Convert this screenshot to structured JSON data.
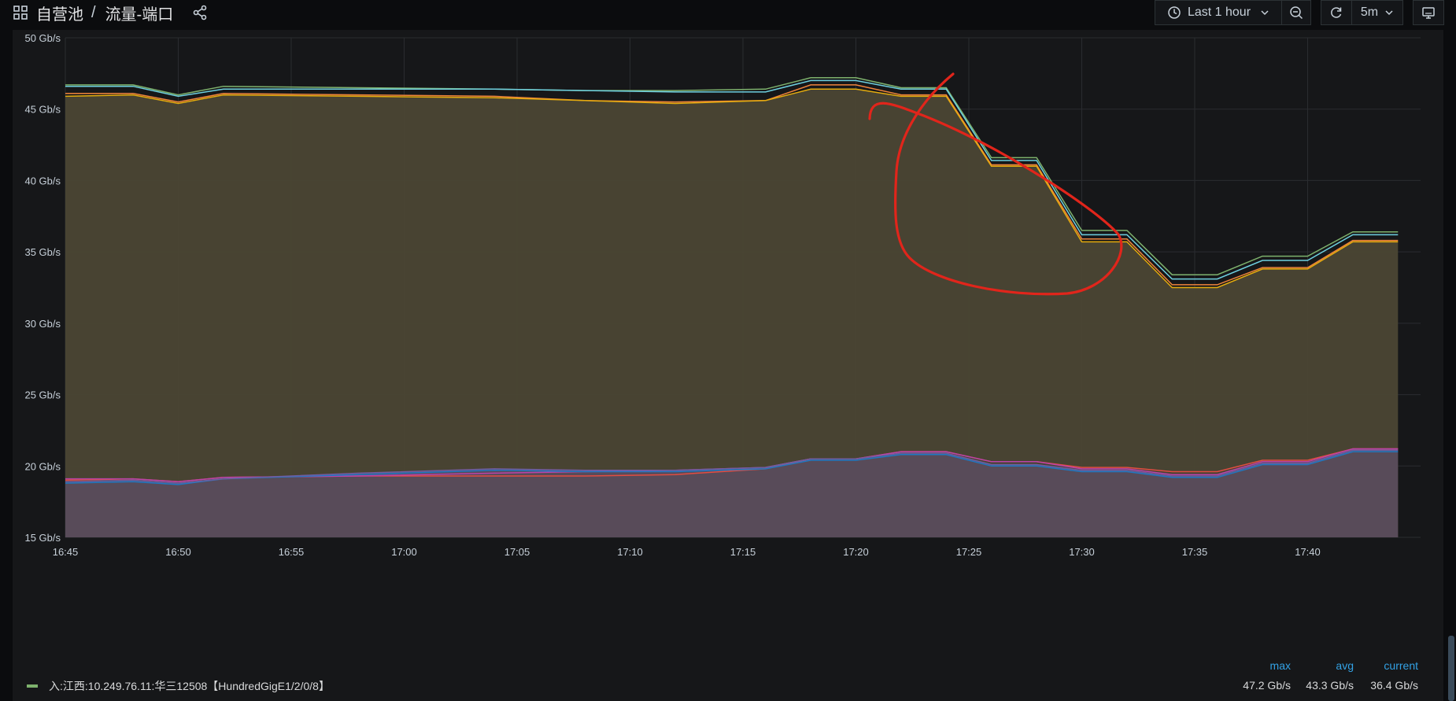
{
  "breadcrumb": {
    "folder": "自营池",
    "separator": "/",
    "dashboard": "流量-端口"
  },
  "toolbar": {
    "time_range": "Last 1 hour",
    "refresh_interval": "5m"
  },
  "icons": {
    "dashboards": "grid-icon",
    "share": "share-icon",
    "clock": "clock-icon",
    "zoom_out": "zoom-out-icon",
    "refresh": "refresh-icon",
    "tv_mode": "tv-mode-icon"
  },
  "chart_data": {
    "type": "area",
    "y_unit": "Gb/s",
    "ylim": [
      15,
      50
    ],
    "ytick_labels": [
      "15 Gb/s",
      "20 Gb/s",
      "25 Gb/s",
      "30 Gb/s",
      "35 Gb/s",
      "40 Gb/s",
      "45 Gb/s",
      "50 Gb/s"
    ],
    "yticks": [
      15,
      20,
      25,
      30,
      35,
      40,
      45,
      50
    ],
    "xtick_labels": [
      "16:45",
      "16:50",
      "16:55",
      "17:00",
      "17:05",
      "17:10",
      "17:15",
      "17:20",
      "17:25",
      "17:30",
      "17:35",
      "17:40"
    ],
    "x": [
      "16:45",
      "16:48",
      "16:50",
      "16:52",
      "16:58",
      "17:04",
      "17:08",
      "17:12",
      "17:16",
      "17:18",
      "17:20",
      "17:22",
      "17:24",
      "17:26",
      "17:28",
      "17:30",
      "17:32",
      "17:34",
      "17:36",
      "17:38",
      "17:40",
      "17:42",
      "17:44"
    ],
    "grid": true,
    "series": [
      {
        "color": "#7eb26d",
        "values": [
          46.7,
          46.7,
          46.0,
          46.6,
          46.5,
          46.4,
          46.3,
          46.3,
          46.4,
          47.2,
          47.2,
          46.5,
          46.5,
          41.6,
          41.6,
          36.5,
          36.5,
          33.4,
          33.4,
          34.7,
          34.7,
          36.4,
          36.4
        ]
      },
      {
        "color": "#6ed0e0",
        "values": [
          46.6,
          46.6,
          45.9,
          46.4,
          46.4,
          46.4,
          46.3,
          46.2,
          46.2,
          47.0,
          47.0,
          46.4,
          46.4,
          41.4,
          41.4,
          36.2,
          36.2,
          33.1,
          33.1,
          34.4,
          34.4,
          36.2,
          36.2
        ]
      },
      {
        "color": "#ef843c",
        "values": [
          46.1,
          46.1,
          45.5,
          46.1,
          46.0,
          45.9,
          45.6,
          45.5,
          45.6,
          46.7,
          46.7,
          46.0,
          46.0,
          41.1,
          41.1,
          35.9,
          35.9,
          32.7,
          32.7,
          33.9,
          33.9,
          35.8,
          35.8
        ]
      },
      {
        "color": "#e5ac0e",
        "values": [
          45.9,
          46.0,
          45.4,
          46.0,
          45.9,
          45.8,
          45.6,
          45.4,
          45.6,
          46.4,
          46.4,
          45.9,
          45.9,
          41.0,
          41.0,
          35.7,
          35.7,
          32.5,
          32.5,
          33.8,
          33.8,
          35.7,
          35.7
        ]
      },
      {
        "color": "#e24d42",
        "values": [
          19.0,
          19.1,
          18.9,
          19.2,
          19.3,
          19.3,
          19.3,
          19.4,
          19.8,
          20.5,
          20.5,
          21.0,
          21.0,
          20.3,
          20.3,
          19.9,
          19.9,
          19.6,
          19.6,
          20.4,
          20.4,
          21.2,
          21.2
        ]
      },
      {
        "color": "#ba43a9",
        "values": [
          19.1,
          19.1,
          18.9,
          19.2,
          19.3,
          19.5,
          19.6,
          19.7,
          19.9,
          20.5,
          20.5,
          21.0,
          21.0,
          20.3,
          20.3,
          19.8,
          19.8,
          19.4,
          19.4,
          20.3,
          20.3,
          21.2,
          21.2
        ]
      },
      {
        "color": "#1f78c1",
        "values": [
          18.8,
          18.9,
          18.7,
          19.1,
          19.4,
          19.7,
          19.6,
          19.6,
          19.8,
          20.4,
          20.4,
          20.8,
          20.8,
          20.0,
          20.0,
          19.6,
          19.6,
          19.2,
          19.2,
          20.1,
          20.1,
          21.0,
          21.0
        ]
      },
      {
        "color": "#705da0",
        "values": [
          18.9,
          19.0,
          18.8,
          19.1,
          19.5,
          19.8,
          19.7,
          19.7,
          19.9,
          20.5,
          20.5,
          20.9,
          20.9,
          20.1,
          20.1,
          19.7,
          19.7,
          19.3,
          19.3,
          20.2,
          20.2,
          21.1,
          21.1
        ]
      }
    ]
  },
  "legend": {
    "headers": {
      "max": "max",
      "avg": "avg",
      "current": "current"
    },
    "items": [
      {
        "color": "#7eb26d",
        "name": "入:江西:10.249.76.11:华三12508【HundredGigE1/2/0/8】",
        "max": "47.2 Gb/s",
        "avg": "43.3 Gb/s",
        "current": "36.4 Gb/s"
      }
    ]
  }
}
